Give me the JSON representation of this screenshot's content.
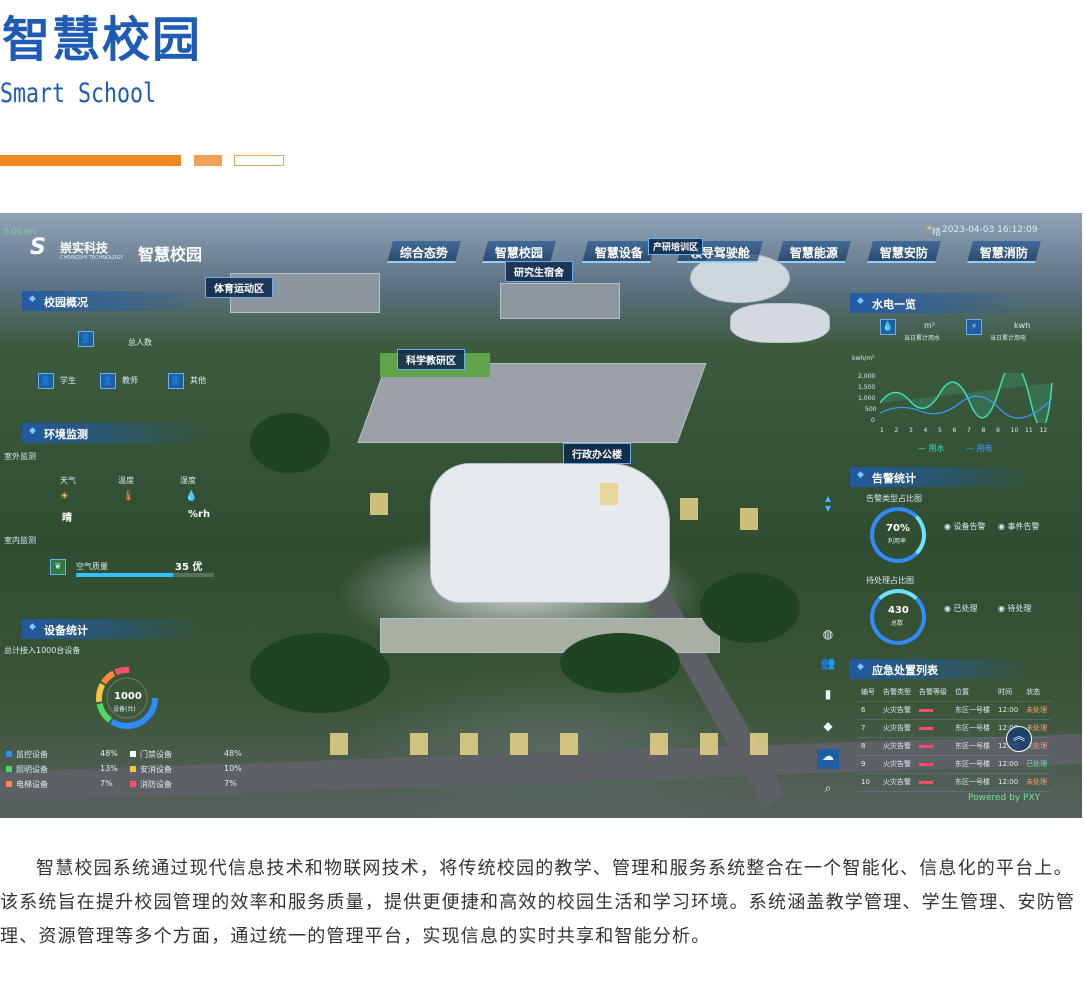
{
  "page": {
    "title": "智慧校园",
    "subtitle": "Smart School"
  },
  "dashboard": {
    "brand": {
      "name": "崇实科技",
      "sub": "CHONGSHI TECHNOLOGY",
      "system": "智慧校园",
      "signal": "5.00 ms"
    },
    "datetime": "2023-04-03 16:12:09",
    "weather_icon": "sun-icon",
    "weather_label": "晴",
    "tabs": [
      "综合态势",
      "智慧校园",
      "智慧设备",
      "领导驾驶舱",
      "智慧能源",
      "智慧安防",
      "智慧消防"
    ],
    "map_tags": [
      "体育运动区",
      "研究生宿舍",
      "科学教研区",
      "行政办公楼",
      "产研培训区"
    ],
    "campus": {
      "header": "校园概况",
      "labels": [
        "总人数",
        "学生",
        "教师",
        "其他"
      ]
    },
    "env": {
      "header": "环境监测",
      "outdoor": "室外监测",
      "indoor": "室内监测",
      "cols": [
        "天气",
        "温度",
        "湿度"
      ],
      "weather": "晴",
      "humidity_unit": "%rh",
      "air_label": "空气质量",
      "air_value": "35 优"
    },
    "devices": {
      "header": "设备统计",
      "total_label": "总计接入1000台设备",
      "center_value": "1000",
      "center_unit": "设备(台)",
      "legend": [
        {
          "name": "监控设备",
          "pct": "48%",
          "color": "#2f8cff"
        },
        {
          "name": "门禁设备",
          "pct": "48%",
          "color": "#ffffff"
        },
        {
          "name": "照明设备",
          "pct": "13%",
          "color": "#4cd964"
        },
        {
          "name": "安消设备",
          "pct": "10%",
          "color": "#f5c542"
        },
        {
          "name": "电梯设备",
          "pct": "7%",
          "color": "#ff8a3d"
        },
        {
          "name": "消防设备",
          "pct": "7%",
          "color": "#ff4d6a"
        }
      ]
    },
    "water": {
      "header": "水电一览",
      "water_unit": "m³",
      "water_label": "当日累计用水",
      "power_unit": "kwh",
      "power_label": "当日累计用电",
      "y_unit": "kwh/m³",
      "y_ticks": [
        "2,000",
        "1,500",
        "1,000",
        "500",
        "0"
      ],
      "x_ticks": [
        "1",
        "2",
        "3",
        "4",
        "5",
        "6",
        "7",
        "8",
        "9",
        "10",
        "11",
        "12"
      ],
      "legend": [
        "用水",
        "用电"
      ]
    },
    "alarm": {
      "header": "告警统计",
      "type_label": "告警类型占比图",
      "rate_value": "70%",
      "rate_label": "利用率",
      "legend1": [
        "设备告警",
        "事件告警"
      ],
      "pending_label": "待处理占比图",
      "pending_value": "430",
      "pending_unit": "总数",
      "legend2": [
        "已处理",
        "待处理"
      ]
    },
    "emergency": {
      "header": "应急处置列表",
      "cols": [
        "编号",
        "告警类型",
        "告警等级",
        "位置",
        "时间",
        "状态"
      ],
      "rows": [
        {
          "id": "6",
          "type": "火灾告警",
          "loc": "东区一号楼",
          "time": "12:00",
          "status": "未处理"
        },
        {
          "id": "7",
          "type": "火灾告警",
          "loc": "东区一号楼",
          "time": "12:00",
          "status": "未处理"
        },
        {
          "id": "8",
          "type": "火灾告警",
          "loc": "东区一号楼",
          "time": "12:00",
          "status": "未处理"
        },
        {
          "id": "9",
          "type": "火灾告警",
          "loc": "东区一号楼",
          "time": "12:00",
          "status": "已处理"
        },
        {
          "id": "10",
          "type": "火灾告警",
          "loc": "东区一号楼",
          "time": "12:00",
          "status": "未处理"
        }
      ]
    },
    "powered": "Powered by PXY"
  },
  "description": "智慧校园系统通过现代信息技术和物联网技术，将传统校园的教学、管理和服务系统整合在一个智能化、信息化的平台上。该系统旨在提升校园管理的效率和服务质量，提供更便捷和高效的校园生活和学习环境。系统涵盖教学管理、学生管理、安防管理、资源管理等多个方面，通过统一的管理平台，实现信息的实时共享和智能分析。",
  "colors": {
    "accent": "#1e5bb5",
    "orange": "#ef8a23"
  }
}
